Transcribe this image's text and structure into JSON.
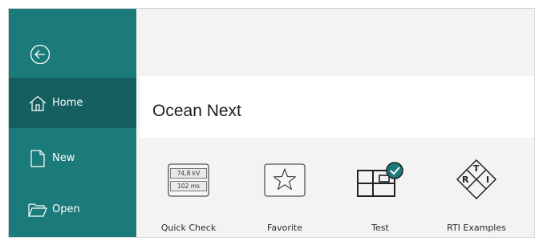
{
  "sidebar": {
    "back_icon": "back-arrow-circle-icon",
    "items": [
      {
        "label": "Home",
        "icon": "home-icon",
        "active": true
      },
      {
        "label": "New",
        "icon": "new-document-icon",
        "active": false
      },
      {
        "label": "Open",
        "icon": "folder-open-icon",
        "active": false
      }
    ]
  },
  "main": {
    "title": "Ocean Next",
    "tiles": [
      {
        "label": "Quick Check",
        "icon": "quick-check-icon",
        "readouts": [
          "74,8 kV",
          "102 ms"
        ]
      },
      {
        "label": "Favorite",
        "icon": "star-icon"
      },
      {
        "label": "Test",
        "icon": "test-icon"
      },
      {
        "label": "RTI Examples",
        "icon": "rti-icon",
        "letters": [
          "R",
          "T",
          "I"
        ]
      }
    ]
  },
  "colors": {
    "sidebar": "#1b7b7b",
    "sidebar_active": "#165f60",
    "content_background": "#f3f3f3",
    "accent": "#1b7b7b"
  }
}
